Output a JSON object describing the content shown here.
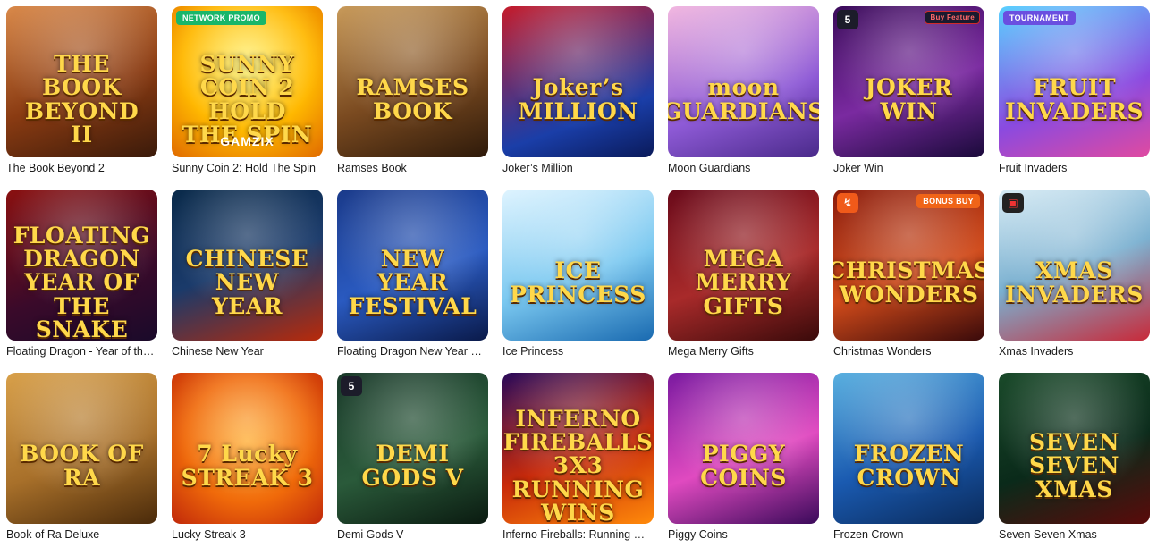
{
  "games": [
    {
      "title": "The Book Beyond 2",
      "logo": "THE BOOK BEYOND II",
      "bg": "linear-gradient(160deg,#d9894a,#8a3b12 55%,#3a1a0a)"
    },
    {
      "title": "Sunny Coin 2: Hold The Spin",
      "logo": "SUNNY COIN 2 HOLD THE SPIN",
      "badge": "NETWORK PROMO",
      "badge_type": "network",
      "maker": "GAMZIX",
      "bg": "radial-gradient(circle at 50% 40%,#fff36a,#ffb800 55%,#e06a00)"
    },
    {
      "title": "Ramses Book",
      "logo": "RAMSES BOOK",
      "bg": "linear-gradient(160deg,#c89a5a,#7a4a20 55%,#2e1a0a)"
    },
    {
      "title": "Joker’s Million",
      "logo": "Joker’s MILLION",
      "bg": "linear-gradient(160deg,#c41c2c,#1a3ea8 70%,#0a1a5a)"
    },
    {
      "title": "Moon Guardians",
      "logo": "moon GUARDIANS",
      "bg": "linear-gradient(160deg,#f2b8e0,#8e5ad6 60%,#4a2a8a)"
    },
    {
      "title": "Joker Win",
      "logo": "JOKER WIN",
      "badge": "Buy Feature",
      "badge_type": "buy",
      "provider": "5",
      "bg": "linear-gradient(160deg,#3a0a5a,#7a2aa0 55%,#1a0a3a)"
    },
    {
      "title": "Fruit Invaders",
      "logo": "FRUIT INVADERS",
      "badge": "TOURNAMENT",
      "badge_type": "tournament",
      "bg": "linear-gradient(160deg,#5ad0ff,#8a4ae0 60%,#e04aa0)"
    },
    {
      "title": "Floating Dragon - Year of the Snake",
      "logo": "FLOATING DRAGON YEAR OF THE SNAKE",
      "bg": "linear-gradient(160deg,#8a1010,#3a0a2a 60%,#1a0a2a)"
    },
    {
      "title": "Chinese New Year",
      "logo": "CHINESE NEW YEAR",
      "bg": "linear-gradient(160deg,#0a2a4a,#1a3a6a 50%,#b82a0a)"
    },
    {
      "title": "Floating Dragon New Year Festival Ultra Megaways Hold & Spin",
      "logo": "NEW YEAR FESTIVAL",
      "bg": "linear-gradient(160deg,#1a3a8a,#2a5ac0 55%,#0a1a4a)"
    },
    {
      "title": "Ice Princess",
      "logo": "ICE PRINCESS",
      "bg": "linear-gradient(160deg,#dff4ff,#7ac8f0 55%,#1a6ab0)"
    },
    {
      "title": "Mega Merry Gifts",
      "logo": "MEGA MERRY GIFTS",
      "bg": "linear-gradient(160deg,#6a0a1a,#a82a2a 55%,#3a0a0a)"
    },
    {
      "title": "Christmas Wonders",
      "logo": "CHRISTMAS WONDERS",
      "badge": "BONUS BUY",
      "badge_type": "bonus",
      "provider": "↯",
      "provider_style": "orange",
      "bg": "linear-gradient(160deg,#8a1a0a,#d04a1a 55%,#3a0a0a)"
    },
    {
      "title": "Xmas Invaders",
      "logo": "XMAS INVADERS",
      "provider": "▣",
      "provider_style": "dark",
      "bg": "linear-gradient(160deg,#d8ecf5,#7ab0d0 50%,#c82a3a)"
    },
    {
      "title": "Book of Ra Deluxe",
      "logo": "BOOK OF RA",
      "bg": "linear-gradient(160deg,#d8a04a,#a8702a 55%,#4a2a0a)"
    },
    {
      "title": "Lucky Streak 3",
      "logo": "7 Lucky STREAK 3",
      "bg": "radial-gradient(circle at 50% 45%,#ffb03a,#f06a0a 55%,#c0280a)"
    },
    {
      "title": "Demi Gods V",
      "logo": "DEMI GODS V",
      "provider": "5",
      "bg": "linear-gradient(160deg,#1a3a2a,#2a5a3a 55%,#0a1a10)"
    },
    {
      "title": "Inferno Fireballs: Running Wins",
      "logo": "INFERNO FIREBALLS 3X3 RUNNING WINS",
      "bg": "linear-gradient(160deg,#2a0a5a,#c82a0a 55%,#ff8a0a)"
    },
    {
      "title": "Piggy Coins",
      "logo": "PIGGY COINS",
      "bg": "linear-gradient(160deg,#7a1aa0,#e04ac0 55%,#3a0a5a)"
    },
    {
      "title": "Frozen Crown",
      "logo": "FROZEN CROWN",
      "bg": "linear-gradient(160deg,#5ab0e0,#1a5ab0 55%,#0a2a5a)"
    },
    {
      "title": "Seven Seven Xmas",
      "logo": "SEVEN SEVEN XMAS",
      "bg": "linear-gradient(160deg,#1a4a2a,#0a2a1a 55%,#5a0a0a)"
    }
  ]
}
